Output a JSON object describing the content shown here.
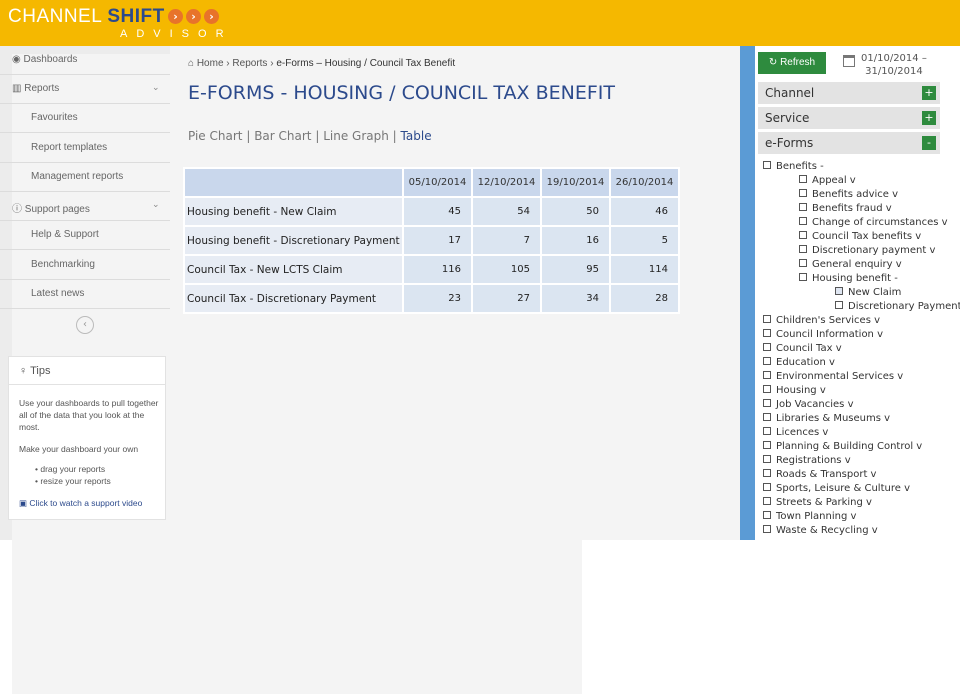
{
  "brand": {
    "line1_a": "CHANNEL ",
    "line1_b": "SHIFT",
    "line2": "ADVISOR",
    "chevron": "›"
  },
  "sidebar": {
    "items": [
      {
        "label": "Dashboards",
        "icon": "speedometer-icon",
        "type": "main"
      },
      {
        "label": "Reports",
        "icon": "bar-chart-icon",
        "type": "main",
        "caret": "⌄"
      },
      {
        "label": "Favourites",
        "type": "sub"
      },
      {
        "label": "Report templates",
        "type": "sub"
      },
      {
        "label": "Management reports",
        "type": "sub"
      },
      {
        "label": "Support pages",
        "icon": "info-icon",
        "type": "main",
        "caret": "⌄"
      },
      {
        "label": "Help & Support",
        "type": "sub"
      },
      {
        "label": "Benchmarking",
        "type": "sub"
      },
      {
        "label": "Latest news",
        "type": "sub"
      }
    ],
    "collapse": "‹",
    "tips": {
      "title": "Tips",
      "p1": "Use your dashboards to pull together all of the data that you look at the most.",
      "p2": "Make your dashboard your own",
      "b1": "drag your reports",
      "b2": "resize your reports",
      "link": "Click to watch a support video"
    }
  },
  "breadcrumb": {
    "home": "Home",
    "reports": "Reports",
    "current": "e-Forms – Housing / Council Tax Benefit",
    "sep": "›"
  },
  "page_title": "E-FORMS - HOUSING / COUNCIL TAX BENEFIT",
  "views": {
    "pie": "Pie Chart",
    "bar": "Bar Chart",
    "line": "Line Graph",
    "table": "Table",
    "sep": "|"
  },
  "table": {
    "columns": [
      "05/10/2014",
      "12/10/2014",
      "19/10/2014",
      "26/10/2014"
    ],
    "rows": [
      {
        "label": "Housing benefit - New Claim",
        "values": [
          "45",
          "54",
          "50",
          "46"
        ]
      },
      {
        "label": "Housing benefit - Discretionary Payment",
        "values": [
          "17",
          "7",
          "16",
          "5"
        ]
      },
      {
        "label": "Council Tax - New LCTS Claim",
        "values": [
          "116",
          "105",
          "95",
          "114"
        ]
      },
      {
        "label": "Council Tax - Discretionary Payment",
        "values": [
          "23",
          "27",
          "34",
          "28"
        ]
      }
    ]
  },
  "filters": {
    "refresh": "Refresh",
    "date_from": "01/10/2014 –",
    "date_to": "31/10/2014",
    "channel": "Channel",
    "service": "Service",
    "eforms": "e-Forms",
    "plus": "+",
    "minus": "-"
  },
  "tree": {
    "benefits": "Benefits -",
    "benefit_children": [
      "Appeal v",
      "Benefits advice v",
      "Benefits fraud v",
      "Change of circumstances v",
      "Council Tax benefits v",
      "Discretionary payment v",
      "General enquiry v",
      "Housing benefit -"
    ],
    "housing_children": [
      "New Claim",
      "Discretionary Payment"
    ],
    "top_services": [
      "Children's Services v",
      "Council Information v",
      "Council Tax v",
      "Education v",
      "Environmental Services v",
      "Housing v",
      "Job Vacancies v",
      "Libraries & Museums v",
      "Licences v",
      "Planning & Building Control v",
      "Registrations v",
      "Roads & Transport v",
      "Sports, Leisure & Culture v",
      "Streets & Parking v",
      "Town Planning v",
      "Waste & Recycling v"
    ]
  },
  "colors": {
    "brand_yellow": "#f5b800",
    "brand_blue": "#2c4a8c",
    "accent_green": "#2e8b3e",
    "stripe_blue": "#5b9bd5"
  }
}
